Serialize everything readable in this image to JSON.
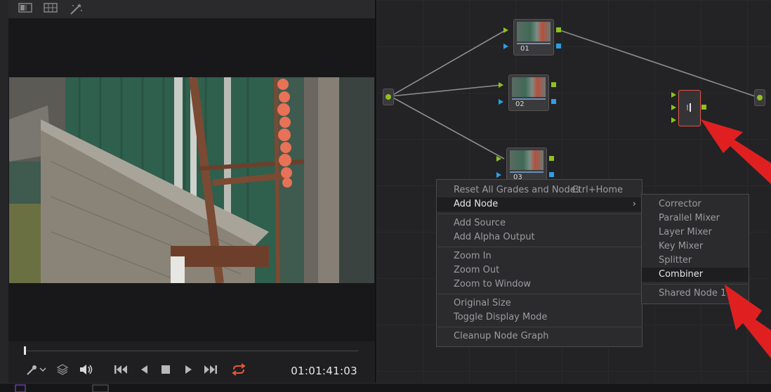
{
  "viewer": {
    "timecode": "01:01:41:03",
    "toolbar_icons": [
      "split-view-icon",
      "grid-view-icon",
      "magic-wand-icon"
    ],
    "transport_icons": [
      "picker-icon",
      "layers-icon",
      "volume-icon",
      "skip-back-icon",
      "play-reverse-icon",
      "stop-icon",
      "play-icon",
      "skip-forward-icon",
      "loop-icon"
    ]
  },
  "nodes": [
    {
      "label": "01"
    },
    {
      "label": "02"
    },
    {
      "label": "03"
    }
  ],
  "context_menu": {
    "reset_all": "Reset All Grades and Nodes",
    "reset_shortcut": "Ctrl+Home",
    "add_node": "Add Node",
    "add_source": "Add Source",
    "add_alpha_output": "Add Alpha Output",
    "zoom_in": "Zoom In",
    "zoom_out": "Zoom Out",
    "zoom_to_window": "Zoom to Window",
    "original_size": "Original Size",
    "toggle_display_mode": "Toggle Display Mode",
    "cleanup_node_graph": "Cleanup Node Graph"
  },
  "submenu": {
    "corrector": "Corrector",
    "parallel_mixer": "Parallel Mixer",
    "layer_mixer": "Layer Mixer",
    "key_mixer": "Key Mixer",
    "splitter": "Splitter",
    "combiner": "Combiner",
    "shared_node": "Shared Node 1"
  },
  "colors": {
    "accent_red": "#e02020",
    "input_green": "#8ec21e",
    "output_blue": "#2aa0e6",
    "loop_icon": "#e8583a"
  }
}
